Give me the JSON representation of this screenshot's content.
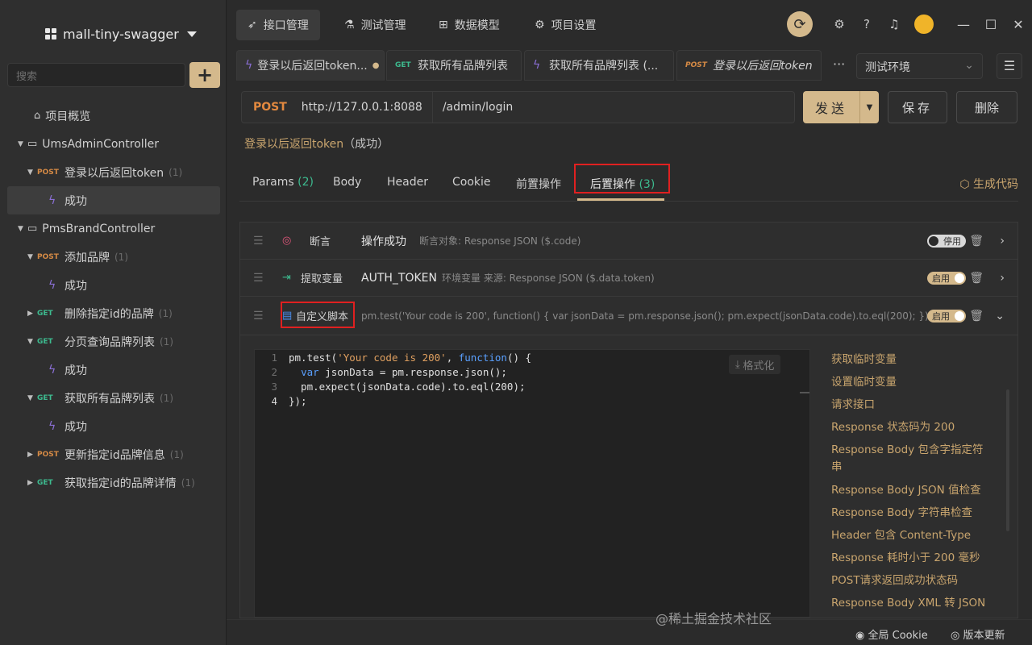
{
  "sidebar": {
    "project_name": "mall-tiny-swagger",
    "search_placeholder": "搜索",
    "overview": "项目概览",
    "tree": [
      {
        "kind": "folder",
        "label": "UmsAdminController"
      },
      {
        "kind": "api",
        "method": "POST",
        "label": "登录以后返回token",
        "count": "(1)"
      },
      {
        "kind": "case",
        "label": "成功",
        "selected": true
      },
      {
        "kind": "folder",
        "label": "PmsBrandController"
      },
      {
        "kind": "api",
        "method": "POST",
        "label": "添加品牌",
        "count": "(1)"
      },
      {
        "kind": "case",
        "label": "成功"
      },
      {
        "kind": "api",
        "method": "GET",
        "label": "删除指定id的品牌",
        "count": "(1)"
      },
      {
        "kind": "api",
        "method": "GET",
        "label": "分页查询品牌列表",
        "count": "(1)"
      },
      {
        "kind": "case",
        "label": "成功"
      },
      {
        "kind": "api",
        "method": "GET",
        "label": "获取所有品牌列表",
        "count": "(1)"
      },
      {
        "kind": "case",
        "label": "成功"
      },
      {
        "kind": "api",
        "method": "POST",
        "label": "更新指定id品牌信息",
        "count": "(1)"
      },
      {
        "kind": "api",
        "method": "GET",
        "label": "获取指定id的品牌详情",
        "count": "(1)"
      }
    ]
  },
  "top_tabs": [
    "接口管理",
    "测试管理",
    "数据模型",
    "项目设置"
  ],
  "request_tabs": [
    {
      "label": "登录以后返回token...",
      "method": ""
    },
    {
      "label": "获取所有品牌列表",
      "method": "GET"
    },
    {
      "label": "获取所有品牌列表 (...",
      "method": ""
    },
    {
      "label": "登录以后返回token",
      "method": "POST"
    }
  ],
  "env": "测试环境",
  "url": {
    "method": "POST",
    "host": "http://127.0.0.1:8088",
    "path": "/admin/login"
  },
  "buttons": {
    "send": "发送",
    "save": "保存",
    "delete": "删除"
  },
  "request_name": "登录以后返回token",
  "request_status": "（成功）",
  "sub_tabs": {
    "params": "Params",
    "params_count": "(2)",
    "body": "Body",
    "header": "Header",
    "cookie": "Cookie",
    "pre": "前置操作",
    "post": "后置操作",
    "post_count": "(3)",
    "gen_code": "生成代码"
  },
  "operations": [
    {
      "type": "断言",
      "main": "操作成功",
      "sub": "断言对象: Response JSON ($.code)",
      "toggle": "停用"
    },
    {
      "type": "提取变量",
      "main": "AUTH_TOKEN",
      "sub": "环境变量     来源: Response JSON ($.data.token)",
      "toggle": "启用"
    },
    {
      "type": "自定义脚本",
      "main": "",
      "sub": "pm.test('Your code is 200', function() { var jsonData = pm.response.json(); pm.expect(jsonData.code).to.eql(200); });",
      "toggle": "启用"
    }
  ],
  "editor": {
    "format_label": "格式化",
    "line_numbers": [
      "1",
      "2",
      "3",
      "4"
    ]
  },
  "snippets": [
    "获取临时变量",
    "设置临时变量",
    "请求接口",
    "Response 状态码为 200",
    "Response Body 包含字指定符串",
    "Response Body JSON 值检查",
    "Response Body 字符串检查",
    "Header 包含 Content-Type",
    "Response 耗时小于 200 毫秒",
    "POST请求返回成功状态码",
    "Response Body XML 转 JSON"
  ],
  "footer": {
    "cookie": "全局 Cookie",
    "update": "版本更新",
    "watermark": "@稀土掘金技术社区"
  }
}
